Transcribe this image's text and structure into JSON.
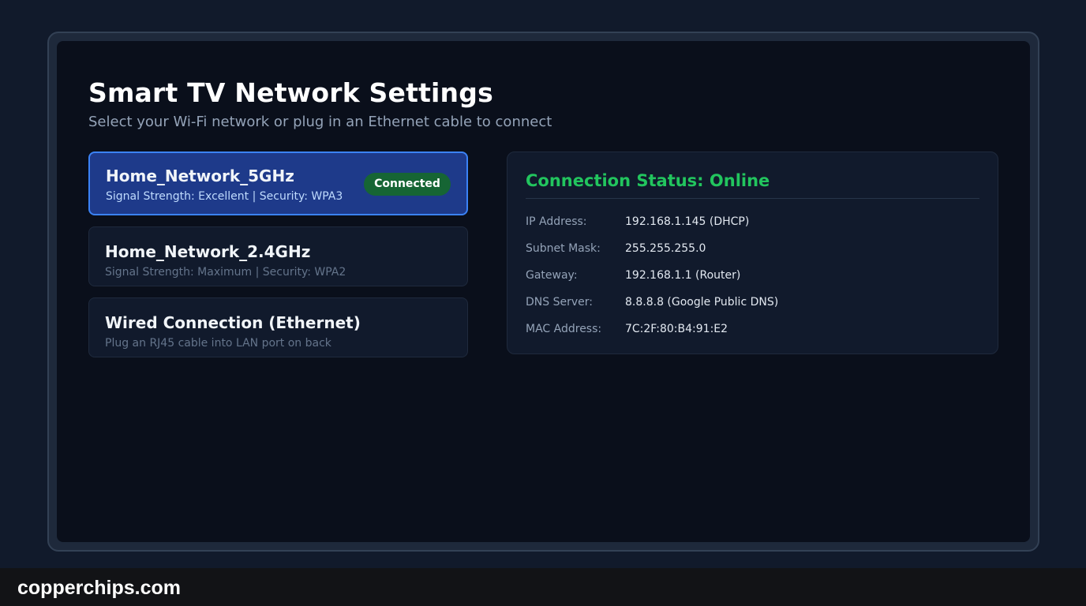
{
  "page": {
    "title": "Smart TV Network Settings",
    "subtitle": "Select your Wi-Fi network or plug in an Ethernet cable to connect"
  },
  "networks": [
    {
      "name": "Home_Network_5GHz",
      "details": "Signal Strength: Excellent | Security: WPA3",
      "badge": "Connected",
      "selected": true
    },
    {
      "name": "Home_Network_2.4GHz",
      "details": "Signal Strength: Maximum | Security: WPA2",
      "selected": false
    },
    {
      "name": "Wired Connection (Ethernet)",
      "details": "Plug an RJ45 cable into LAN port on back",
      "selected": false
    }
  ],
  "status": {
    "heading": "Connection Status: Online",
    "rows": [
      {
        "label": "IP Address:",
        "value": "192.168.1.145 (DHCP)"
      },
      {
        "label": "Subnet Mask:",
        "value": "255.255.255.0"
      },
      {
        "label": "Gateway:",
        "value": "192.168.1.1 (Router)"
      },
      {
        "label": "DNS Server:",
        "value": "8.8.8.8 (Google Public DNS)"
      },
      {
        "label": "MAC Address:",
        "value": "7C:2F:80:B4:91:E2"
      }
    ]
  },
  "footer": {
    "brand": "copperchips.com"
  },
  "colors": {
    "page_background": "#111a2b",
    "screen_background": "#0a0f1b",
    "selected_item": "#1e3a8a",
    "selected_border": "#3b82f6",
    "online_green": "#22c55e",
    "connected_badge": "#166534"
  }
}
